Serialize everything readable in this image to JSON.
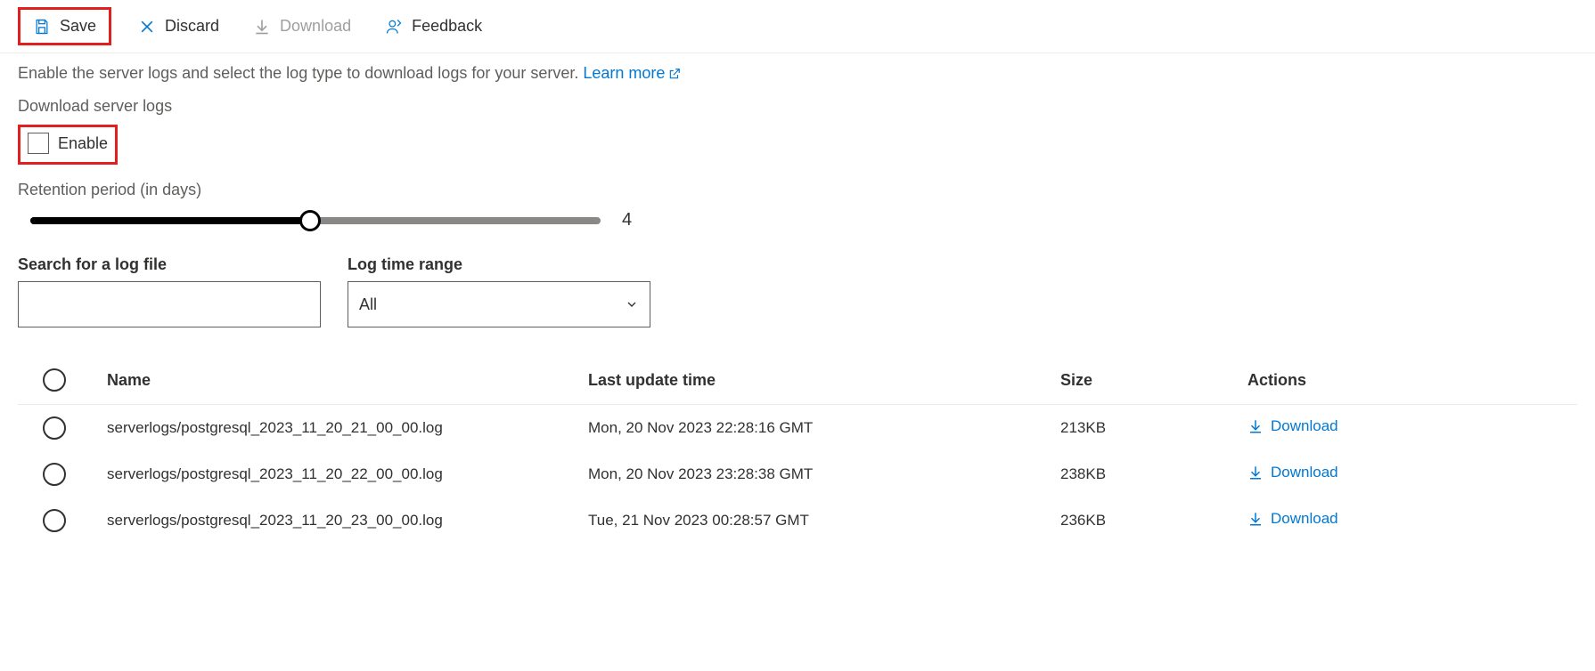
{
  "toolbar": {
    "save_label": "Save",
    "discard_label": "Discard",
    "download_label": "Download",
    "feedback_label": "Feedback"
  },
  "description": "Enable the server logs and select the log type to download logs for your server.",
  "learn_more": "Learn more",
  "download_logs_label": "Download server logs",
  "enable_label": "Enable",
  "retention_label": "Retention period (in days)",
  "retention_value": "4",
  "search_label": "Search for a log file",
  "search_value": "",
  "time_range_label": "Log time range",
  "time_range_value": "All",
  "table": {
    "headers": {
      "name": "Name",
      "last_update": "Last update time",
      "size": "Size",
      "actions": "Actions"
    },
    "rows": [
      {
        "name": "serverlogs/postgresql_2023_11_20_21_00_00.log",
        "last_update": "Mon, 20 Nov 2023 22:28:16 GMT",
        "size": "213KB",
        "action": "Download"
      },
      {
        "name": "serverlogs/postgresql_2023_11_20_22_00_00.log",
        "last_update": "Mon, 20 Nov 2023 23:28:38 GMT",
        "size": "238KB",
        "action": "Download"
      },
      {
        "name": "serverlogs/postgresql_2023_11_20_23_00_00.log",
        "last_update": "Tue, 21 Nov 2023 00:28:57 GMT",
        "size": "236KB",
        "action": "Download"
      }
    ]
  }
}
